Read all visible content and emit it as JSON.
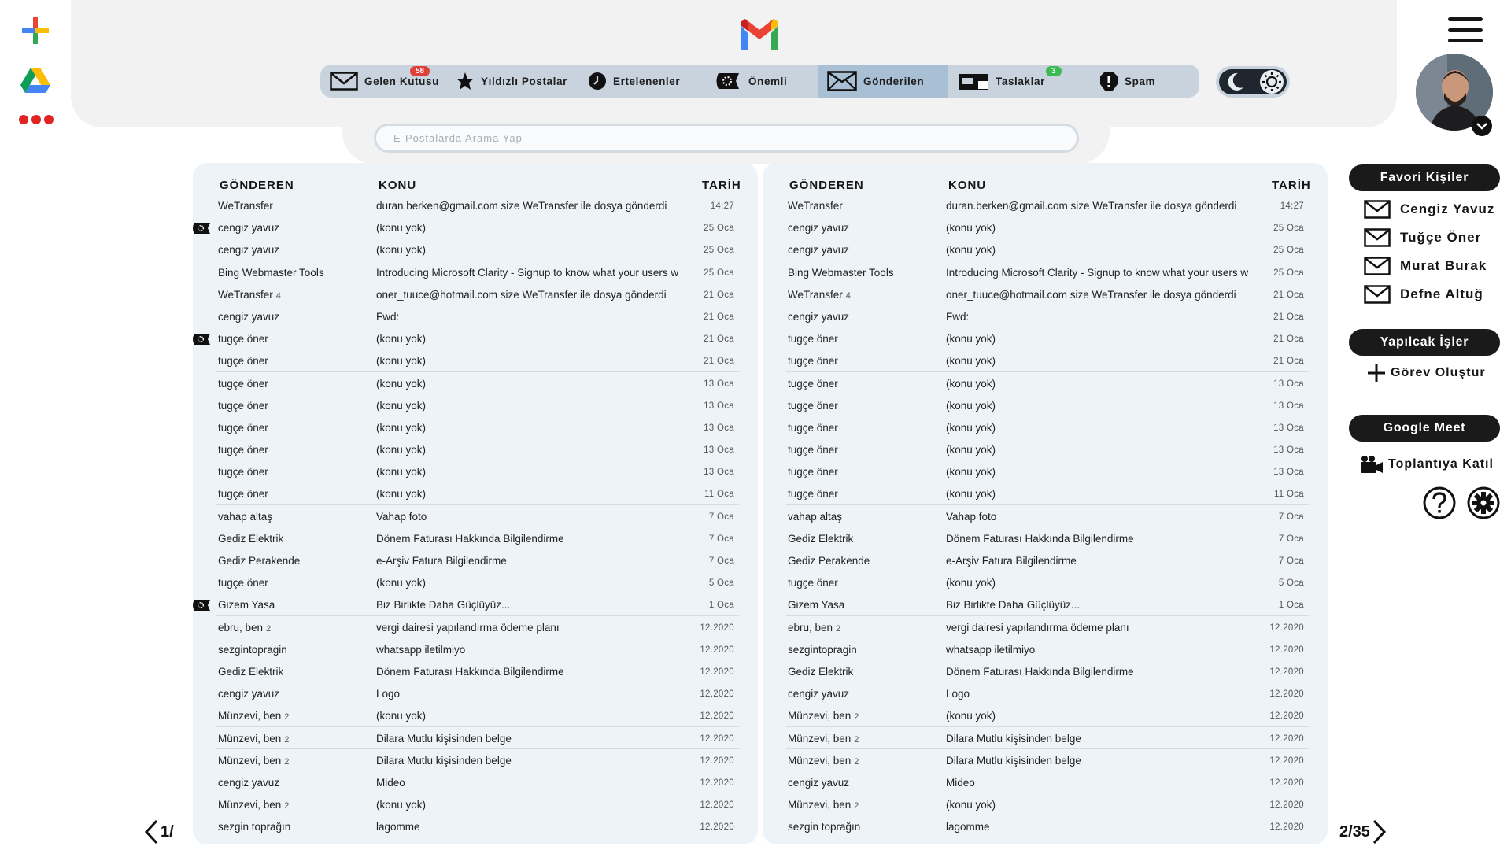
{
  "header": {
    "nav": [
      {
        "label": "Gelen Kutusu",
        "icon": "inbox-icon",
        "badge": "58"
      },
      {
        "label": "Yıldızlı Postalar",
        "icon": "star-icon"
      },
      {
        "label": "Ertelenenler",
        "icon": "clock-icon"
      },
      {
        "label": "Önemli",
        "icon": "important-icon"
      },
      {
        "label": "Gönderilen",
        "icon": "sent-icon"
      },
      {
        "label": "Taslaklar",
        "icon": "drafts-icon",
        "badge": "3"
      },
      {
        "label": "Spam",
        "icon": "spam-icon"
      }
    ],
    "search_placeholder": "E-Postalarda Arama Yap"
  },
  "colors": {
    "nav_bg": "#c8d3de",
    "nav_active": "#a8bfd4",
    "badge_red": "#e0403a",
    "badge_green": "#3cba54",
    "panel_bg": "#eef3f7"
  },
  "columns": {
    "sender": "GÖNDEREN",
    "subject": "KONU",
    "date": "TARİH"
  },
  "emails": [
    {
      "sender": "WeTransfer",
      "count": "",
      "subject": "duran.berken@gmail.com size WeTransfer ile dosya gönderdi",
      "date": "14:27",
      "important": false
    },
    {
      "sender": "cengiz yavuz",
      "count": "",
      "subject": "(konu yok)",
      "date": "25 Oca",
      "important": true
    },
    {
      "sender": "cengiz yavuz",
      "count": "",
      "subject": "(konu yok)",
      "date": "25 Oca",
      "important": false
    },
    {
      "sender": "Bing Webmaster Tools",
      "count": "",
      "subject": "Introducing Microsoft Clarity - Signup to know what your users w",
      "date": "25 Oca",
      "important": false
    },
    {
      "sender": "WeTransfer",
      "count": "4",
      "subject": "oner_tuuce@hotmail.com size WeTransfer ile dosya gönderdi",
      "date": "21 Oca",
      "important": false
    },
    {
      "sender": "cengiz yavuz",
      "count": "",
      "subject": "Fwd:",
      "date": "21 Oca",
      "important": false
    },
    {
      "sender": "tugçe öner",
      "count": "",
      "subject": "(konu yok)",
      "date": "21 Oca",
      "important": true
    },
    {
      "sender": "tugçe öner",
      "count": "",
      "subject": "(konu yok)",
      "date": "21 Oca",
      "important": false
    },
    {
      "sender": "tugçe öner",
      "count": "",
      "subject": "(konu yok)",
      "date": "13 Oca",
      "important": false
    },
    {
      "sender": "tugçe öner",
      "count": "",
      "subject": "(konu yok)",
      "date": "13 Oca",
      "important": false
    },
    {
      "sender": "tugçe öner",
      "count": "",
      "subject": "(konu yok)",
      "date": "13 Oca",
      "important": false
    },
    {
      "sender": "tugçe öner",
      "count": "",
      "subject": "(konu yok)",
      "date": "13 Oca",
      "important": false
    },
    {
      "sender": "tugçe öner",
      "count": "",
      "subject": "(konu yok)",
      "date": "13 Oca",
      "important": false
    },
    {
      "sender": "tugçe öner",
      "count": "",
      "subject": "(konu yok)",
      "date": "11 Oca",
      "important": false
    },
    {
      "sender": "vahap altaş",
      "count": "",
      "subject": "Vahap foto",
      "date": "7 Oca",
      "important": false
    },
    {
      "sender": "Gediz Elektrik",
      "count": "",
      "subject": "Dönem Faturası Hakkında Bilgilendirme",
      "date": "7 Oca",
      "important": false
    },
    {
      "sender": "Gediz Perakende",
      "count": "",
      "subject": "e-Arşiv Fatura Bilgilendirme",
      "date": "7 Oca",
      "important": false
    },
    {
      "sender": "tugçe öner",
      "count": "",
      "subject": "(konu yok)",
      "date": "5 Oca",
      "important": false
    },
    {
      "sender": "Gizem Yasa",
      "count": "",
      "subject": "Biz Birlikte Daha Güçlüyüz...",
      "date": "1 Oca",
      "important": true
    },
    {
      "sender": "ebru, ben",
      "count": "2",
      "subject": "vergi dairesi yapılandırma ödeme planı",
      "date": "12.2020",
      "important": false
    },
    {
      "sender": "sezgintopragin",
      "count": "",
      "subject": "whatsapp iletilmiyo",
      "date": "12.2020",
      "important": false
    },
    {
      "sender": "Gediz Elektrik",
      "count": "",
      "subject": "Dönem Faturası Hakkında Bilgilendirme",
      "date": "12.2020",
      "important": false
    },
    {
      "sender": "cengiz yavuz",
      "count": "",
      "subject": "Logo",
      "date": "12.2020",
      "important": false
    },
    {
      "sender": "Münzevi, ben",
      "count": "2",
      "subject": "(konu yok)",
      "date": "12.2020",
      "important": false
    },
    {
      "sender": "Münzevi, ben",
      "count": "2",
      "subject": "Dilara Mutlu kişisinden belge",
      "date": "12.2020",
      "important": false
    },
    {
      "sender": "Münzevi, ben",
      "count": "2",
      "subject": "Dilara Mutlu kişisinden belge",
      "date": "12.2020",
      "important": false
    },
    {
      "sender": "cengiz yavuz",
      "count": "",
      "subject": "Mideo",
      "date": "12.2020",
      "important": false
    },
    {
      "sender": "Münzevi, ben",
      "count": "2",
      "subject": "(konu yok)",
      "date": "12.2020",
      "important": false
    },
    {
      "sender": "sezgin toprağın",
      "count": "",
      "subject": "lagomme",
      "date": "12.2020",
      "important": false
    }
  ],
  "pager": {
    "left": "1/",
    "right": "2/35"
  },
  "sidebar": {
    "favorites_title": "Favori Kişiler",
    "favorites": [
      "Cengiz Yavuz",
      "Tuğçe Öner",
      "Murat Burak",
      "Defne Altuğ"
    ],
    "tasks_title": "Yapılcak İşler",
    "create_task": "Görev Oluştur",
    "meet_title": "Google Meet",
    "join_meeting": "Toplantıya Katıl"
  }
}
